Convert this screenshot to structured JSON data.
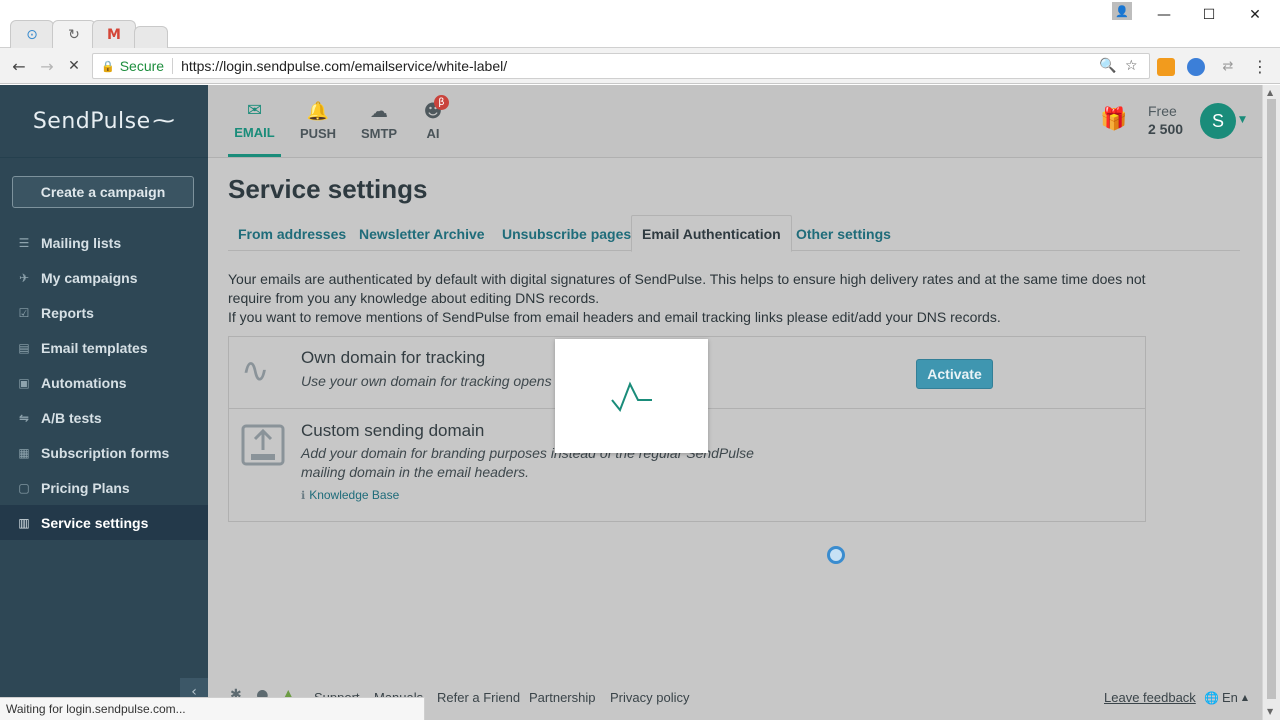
{
  "browser": {
    "tabs": [
      {
        "icon": "sendpulse-favicon",
        "glyph": "⊙"
      },
      {
        "icon": "loading-spinner-icon",
        "glyph": "↻"
      },
      {
        "icon": "gmail-icon",
        "glyph": "M"
      },
      {
        "icon": "new-tab-icon",
        "glyph": ""
      }
    ],
    "secure_label": "Secure",
    "url": "https://login.sendpulse.com/emailservice/white-label/",
    "status_text": "Waiting for login.sendpulse.com..."
  },
  "sidebar": {
    "logo": "SendPulse",
    "create_button": "Create a campaign",
    "items": [
      {
        "label": "Mailing lists",
        "icon": "list-icon"
      },
      {
        "label": "My campaigns",
        "icon": "campaign-icon"
      },
      {
        "label": "Reports",
        "icon": "report-icon"
      },
      {
        "label": "Email templates",
        "icon": "template-icon"
      },
      {
        "label": "Automations",
        "icon": "automation-icon"
      },
      {
        "label": "A/B tests",
        "icon": "ab-test-icon"
      },
      {
        "label": "Subscription forms",
        "icon": "form-icon"
      },
      {
        "label": "Pricing Plans",
        "icon": "pricing-icon"
      },
      {
        "label": "Service settings",
        "icon": "settings-icon",
        "active": true
      }
    ]
  },
  "topnav": {
    "products": [
      {
        "label": "EMAIL",
        "icon": "envelope-icon",
        "active": true
      },
      {
        "label": "PUSH",
        "icon": "bell-icon"
      },
      {
        "label": "SMTP",
        "icon": "cloud-icon"
      },
      {
        "label": "AI",
        "icon": "ai-head-icon"
      }
    ],
    "beta_badge": "β",
    "plan_label": "Free",
    "plan_count": "2 500",
    "avatar_letter": "S"
  },
  "page": {
    "title": "Service settings",
    "tabs": [
      {
        "label": "From addresses"
      },
      {
        "label": "Newsletter Archive"
      },
      {
        "label": "Unsubscribe pages"
      },
      {
        "label": "Email Authentication",
        "active": true
      },
      {
        "label": "Other settings"
      }
    ],
    "intro_1": "Your emails are authenticated by default with digital signatures of SendPulse. This helps to ensure high delivery rates and at the same time does not require from you any knowledge about editing DNS records.",
    "intro_2": "If you want to remove mentions of SendPulse from email headers and email tracking links please edit/add your DNS records.",
    "domains": {
      "tracking": {
        "title": "Own domain for tracking",
        "desc": "Use your own domain for tracking opens a",
        "button": "Activate"
      },
      "sending": {
        "title": "Custom sending domain",
        "desc": "Add your domain for branding purposes instead of the regular SendPulse mailing domain in the email headers.",
        "kb_link": "Knowledge Base"
      }
    }
  },
  "footer": {
    "links": [
      "Support",
      "Manuals",
      "Refer a Friend",
      "Partnership",
      "Privacy policy"
    ],
    "feedback": "Leave feedback",
    "language": "En"
  },
  "colors": {
    "sidebar_bg": "#2e4755",
    "accent": "#1a8c7a",
    "link": "#1f6c7a",
    "activate_button": "#3f96b0",
    "overlay_bg": "#c7c7c7"
  }
}
